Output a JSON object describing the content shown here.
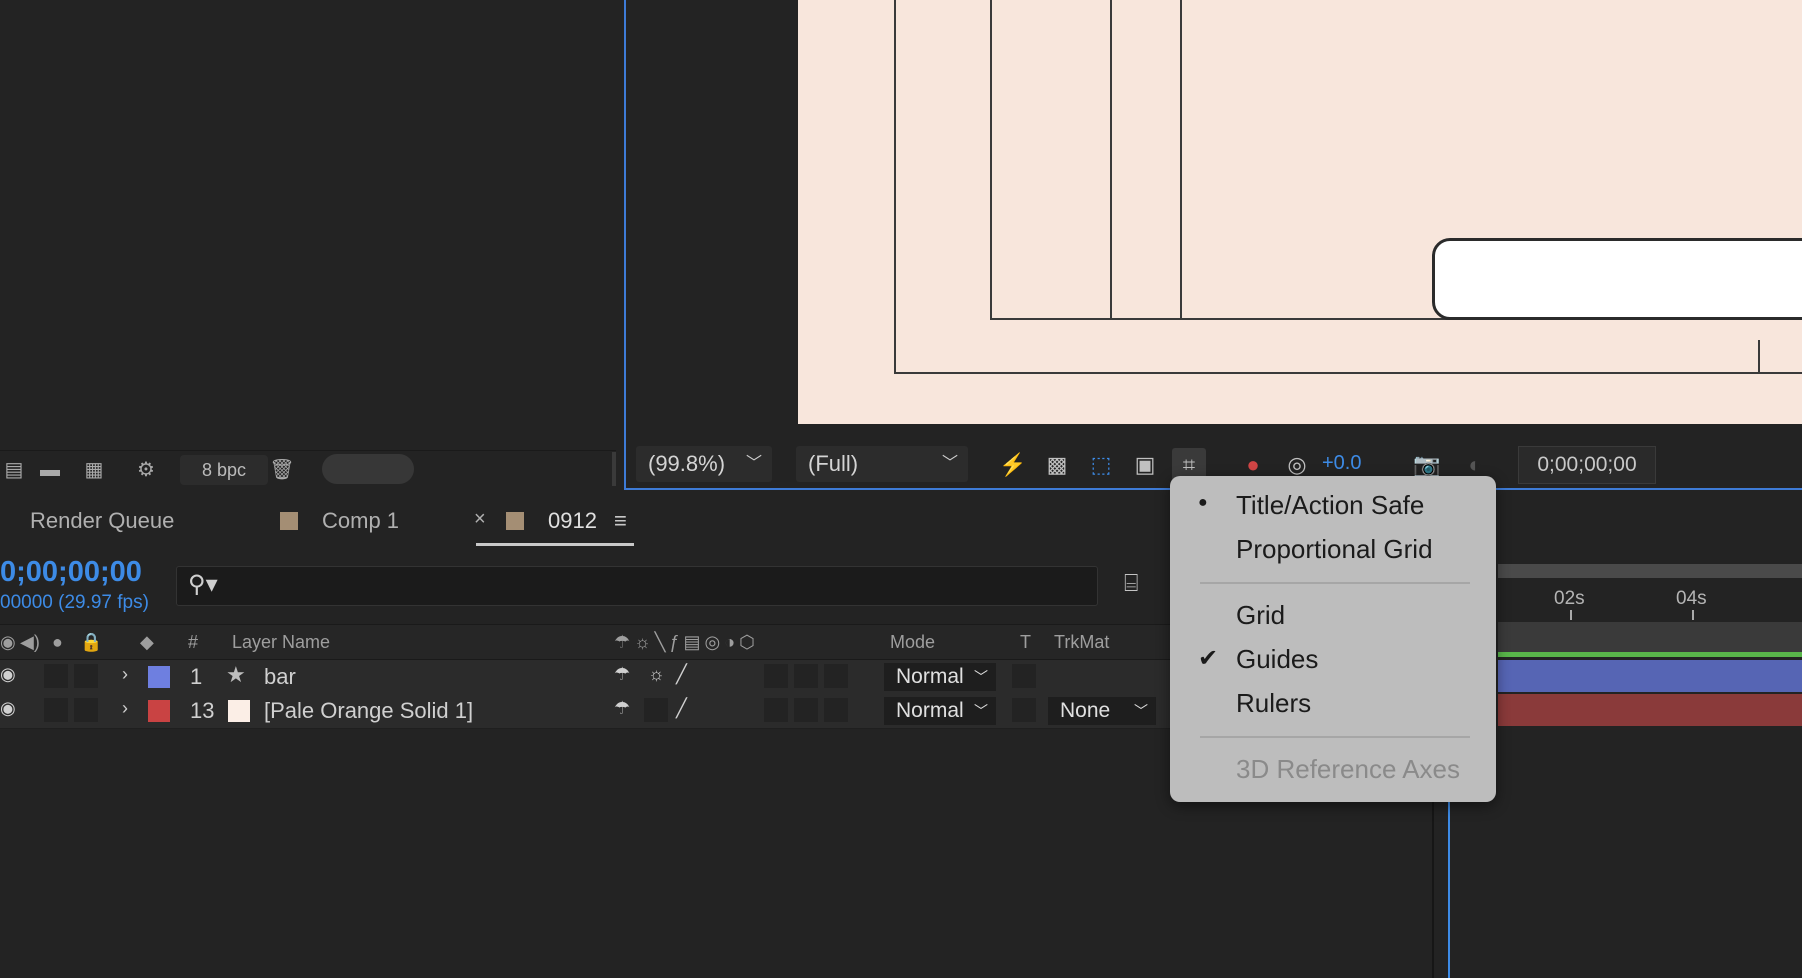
{
  "project_panel": {
    "bpc_label": "8 bpc"
  },
  "viewer": {
    "zoom": "(99.8%)",
    "resolution": "(Full)",
    "exposure": "+0.0",
    "timecode": "0;00;00;00"
  },
  "tabs": [
    {
      "label": "Render Queue"
    },
    {
      "label": "Comp 1"
    },
    {
      "label": "0912",
      "close": "×",
      "active": true
    }
  ],
  "timeline": {
    "timecode": "0;00;00;00",
    "fps": "00000 (29.97 fps)",
    "columns": {
      "hash": "#",
      "layer_name": "Layer Name",
      "mode": "Mode",
      "t": "T",
      "trkmat": "TrkMat"
    },
    "layers": [
      {
        "num": "1",
        "name": "bar",
        "mode": "Normal",
        "trkmat": "",
        "label_color": "#6e7fe0"
      },
      {
        "num": "13",
        "name": "[Pale Orange Solid 1]",
        "mode": "Normal",
        "trkmat": "None",
        "label_color": "#c94343"
      }
    ],
    "ruler_ticks": [
      "02s",
      "04s"
    ]
  },
  "menu": {
    "items": [
      {
        "label": "Title/Action Safe",
        "mark": "●",
        "enabled": true
      },
      {
        "label": "Proportional Grid",
        "mark": "",
        "enabled": true
      },
      {
        "label": "Grid",
        "mark": "",
        "enabled": true
      },
      {
        "label": "Guides",
        "mark": "✔",
        "enabled": true
      },
      {
        "label": "Rulers",
        "mark": "",
        "enabled": true
      },
      {
        "label": "3D Reference Axes",
        "mark": "",
        "enabled": false
      }
    ]
  },
  "colors": {
    "accent": "#3d8be6",
    "canvas": "#f8e6dc",
    "menu_bg": "#bdbdbd"
  }
}
